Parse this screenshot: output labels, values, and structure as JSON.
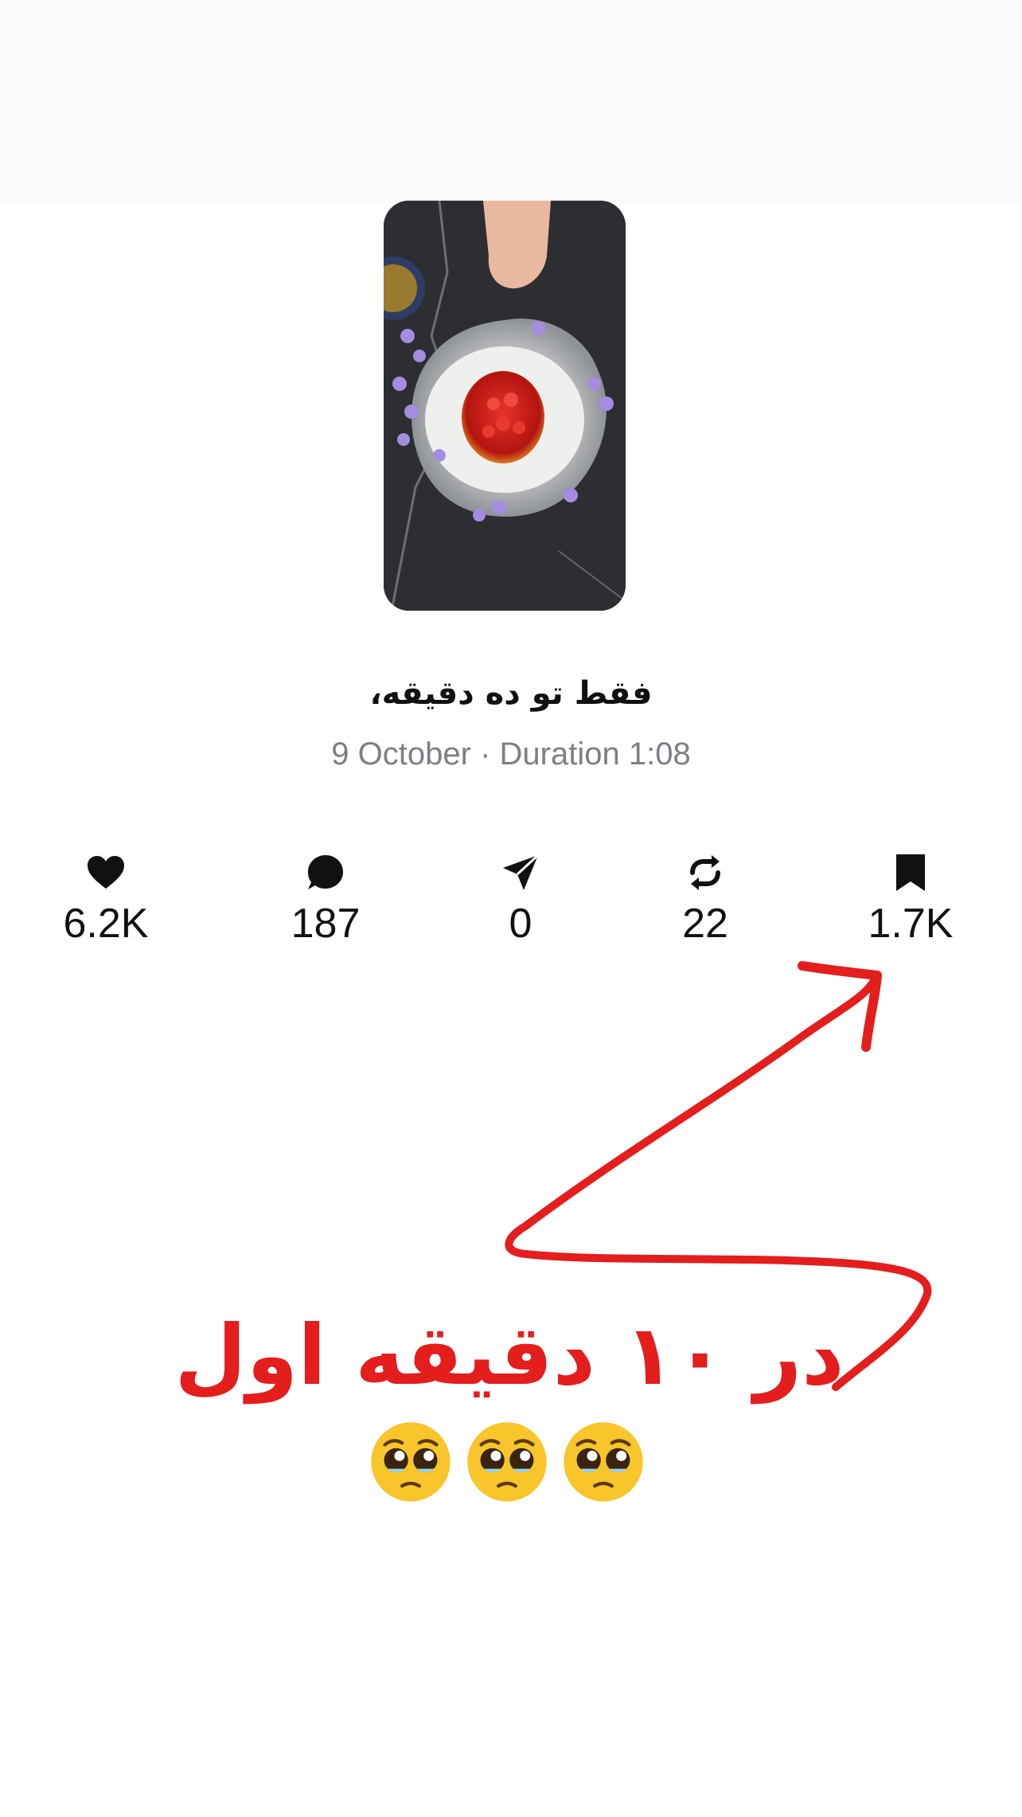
{
  "post": {
    "caption": "فقط تو ده دقیقه،",
    "date": "9 October",
    "separator": "·",
    "duration": "Duration 1:08",
    "meta_line": "9 October · Duration 1:08"
  },
  "stats": {
    "likes": "6.2K",
    "comments": "187",
    "shares": "0",
    "reposts": "22",
    "saves": "1.7K"
  },
  "icons": {
    "likes": "heart-icon",
    "comments": "comment-bubble-icon",
    "shares": "send-icon",
    "reposts": "repost-icon",
    "saves": "bookmark-icon"
  },
  "annotation": {
    "text": "در ۱۰ دقیقه اول",
    "emoji": "🥹🥹🥹",
    "color": "#e41d1d"
  },
  "colors": {
    "text": "#111111",
    "meta": "#7b7f86",
    "annotation": "#e41d1d"
  }
}
